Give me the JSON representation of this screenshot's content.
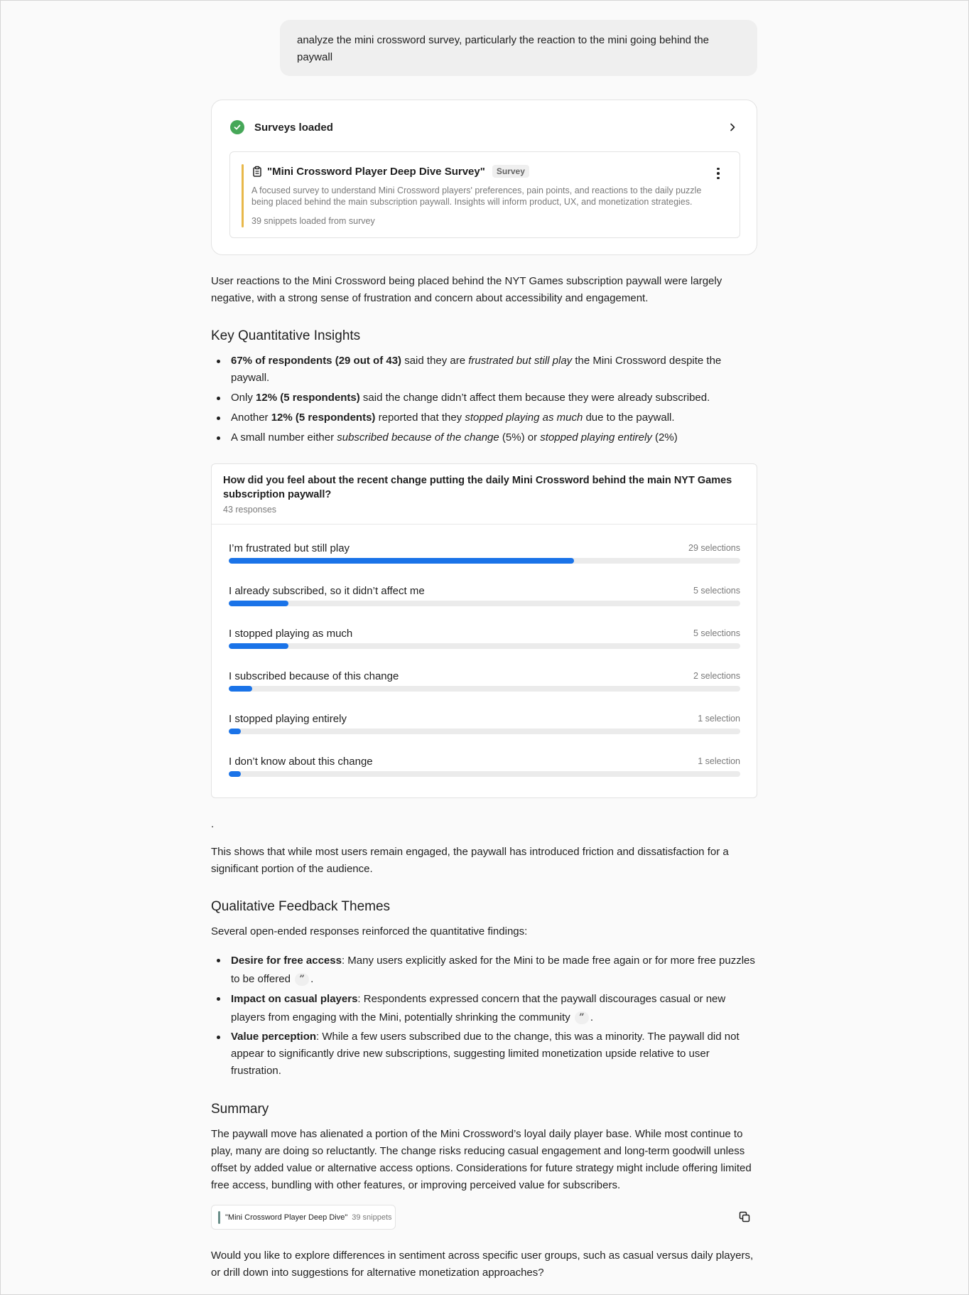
{
  "user_message": "analyze the mini crossword survey, particularly the reaction to the mini going behind the paywall",
  "tool": {
    "title": "Surveys loaded",
    "survey": {
      "title": "\"Mini Crossword Player Deep Dive Survey\"",
      "badge": "Survey",
      "description": "A focused survey to understand Mini Crossword players' preferences, pain points, and reactions to the daily puzzle being placed behind the main subscription paywall. Insights will inform product, UX, and monetization strategies.",
      "footer": "39 snippets loaded from survey"
    }
  },
  "intro": "User reactions to the Mini Crossword being placed behind the NYT Games subscription paywall were largely negative, with a strong sense of frustration and concern about accessibility and engagement.",
  "quant": {
    "heading": "Key Quantitative Insights",
    "b1_bold": "67% of respondents (29 out of 43)",
    "b1_a": " said they are ",
    "b1_i": "frustrated but still play",
    "b1_b": " the Mini Crossword despite the paywall.",
    "b2_a": "Only ",
    "b2_bold": "12% (5 respondents)",
    "b2_b": " said the change didn’t affect them because they were already subscribed.",
    "b3_a": "Another ",
    "b3_bold": "12% (5 respondents)",
    "b3_b": " reported that they ",
    "b3_i": "stopped playing as much",
    "b3_c": " due to the paywall.",
    "b4_a": "A small number either ",
    "b4_i1": "subscribed because of the change",
    "b4_b": " (5%) or ",
    "b4_i2": "stopped playing entirely",
    "b4_c": " (2%)"
  },
  "chart_data": {
    "type": "bar",
    "title": "How did you feel about the recent change putting the daily Mini Crossword behind the main NYT Games subscription paywall?",
    "subtitle": "43 responses",
    "total": 43,
    "categories": [
      "I’m frustrated but still play",
      "I already subscribed, so it didn’t affect me",
      "I stopped playing as much",
      "I subscribed because of this change",
      "I stopped playing entirely",
      "I don’t know about this change"
    ],
    "values": [
      29,
      5,
      5,
      2,
      1,
      1
    ],
    "value_labels": [
      "29 selections",
      "5 selections",
      "5 selections",
      "2 selections",
      "1 selection",
      "1 selection"
    ],
    "bar_color": "#1a73e8"
  },
  "dot": ".",
  "friction": "This shows that while most users remain engaged, the paywall has introduced friction and dissatisfaction for a significant portion of the audience.",
  "qual": {
    "heading": "Qualitative Feedback Themes",
    "intro": "Several open-ended responses reinforced the quantitative findings:",
    "t1_bold": "Desire for free access",
    "t1_text": ": Many users explicitly asked for the Mini to be made free again or for more free puzzles to be offered",
    "t2_bold": "Impact on casual players",
    "t2_text": ": Respondents expressed concern that the paywall discourages casual or new players from engaging with the Mini, potentially shrinking the community",
    "t3_bold": "Value perception",
    "t3_text": ": While a few users subscribed due to the change, this was a minority. The paywall did not appear to significantly drive new subscriptions, suggesting limited monetization upside relative to user frustration.",
    "quote_glyph": "”",
    "period": "."
  },
  "summary": {
    "heading": "Summary",
    "text": "The paywall move has alienated a portion of the Mini Crossword’s loyal daily player base. While most continue to play, many are doing so reluctantly. The change risks reducing casual engagement and long-term goodwill unless offset by added value or alternative access options. Considerations for future strategy might include offering limited free access, bundling with other features, or improving perceived value for subscribers."
  },
  "source": {
    "name": "\"Mini Crossword Player Deep Dive\"",
    "count": "39 snippets"
  },
  "followup": "Would you like to explore differences in sentiment across specific user groups, such as casual versus daily players, or drill down into suggestions for alternative monetization approaches?"
}
